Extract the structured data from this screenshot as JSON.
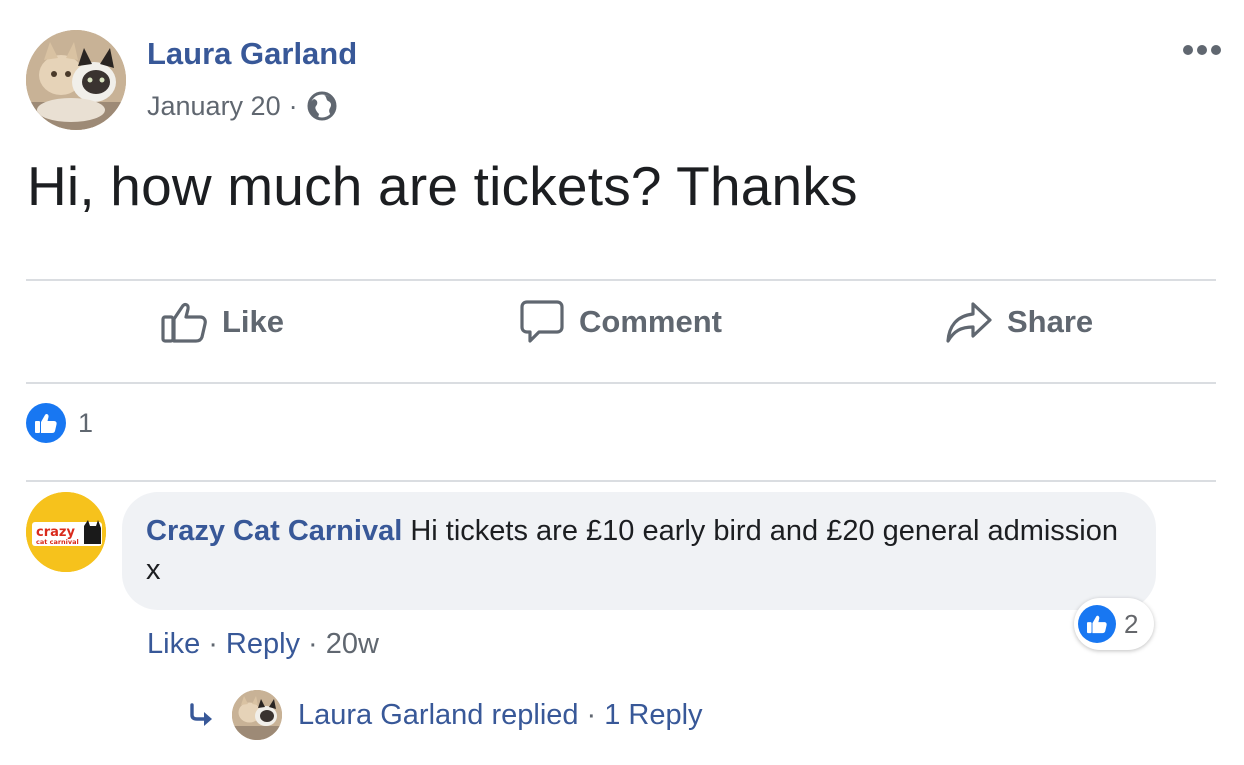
{
  "post": {
    "author": "Laura Garland",
    "date": "January 20",
    "date_separator": "·",
    "privacy_icon": "globe-icon",
    "text": "Hi, how much are tickets? Thanks",
    "more_icon": "more-options-icon"
  },
  "actions": {
    "like_label": "Like",
    "comment_label": "Comment",
    "share_label": "Share"
  },
  "reactions": {
    "count": "1",
    "icon": "like-icon",
    "color": "#1877f2"
  },
  "comment": {
    "author": "Crazy Cat Carnival",
    "logo_text": "crazy",
    "logo_subtext": "cat carnival",
    "text": "Hi tickets are £10 early bird and £20 general admission x",
    "reaction_count": "2",
    "like_label": "Like",
    "reply_label": "Reply",
    "separator": "·",
    "time": "20w"
  },
  "replies": {
    "summary": "Laura Garland replied",
    "separator": "·",
    "count_label": "1 Reply"
  },
  "colors": {
    "link": "#385898",
    "muted": "#606770",
    "divider": "#dadde1",
    "bubble": "#f0f2f5",
    "page_avatar": "#f6c21c"
  }
}
